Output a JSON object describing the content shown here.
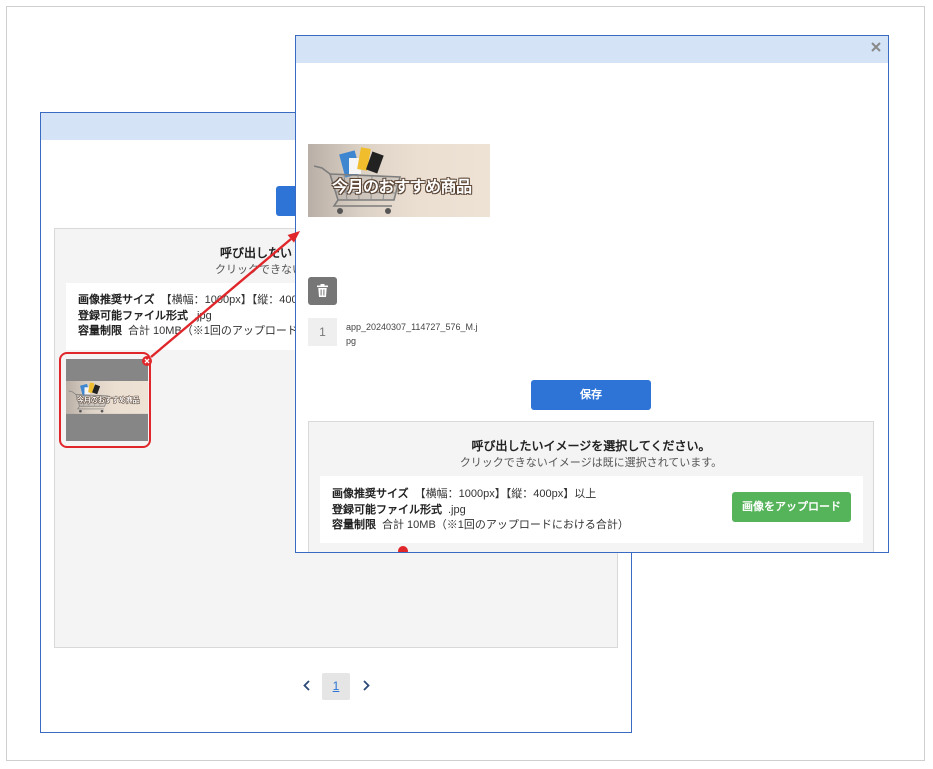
{
  "back_dialog": {
    "panel": {
      "heading": "呼び出したい",
      "subheading": "クリックできない"
    },
    "info": {
      "size_label": "画像推奨サイズ",
      "size_value": "【横幅：1000px】【縦：400p",
      "format_label": "登録可能ファイル形式",
      "format_value": ".jpg",
      "limit_label": "容量制限",
      "limit_value": "合計 10MB（※1回のアップロードに"
    },
    "thumbnail_remove_icon": "close-circle-icon",
    "pagination": {
      "current_page": "1",
      "prev_icon": "chevron-left-icon",
      "next_icon": "chevron-right-icon"
    }
  },
  "front_dialog": {
    "close_icon": "close-icon",
    "banner_text": "今月のおすすめ商品",
    "image_item": {
      "index": "1",
      "filename": "app_20240307_114727_576_M.jpg",
      "delete_icon": "trash-icon"
    },
    "save_label": "保存",
    "panel": {
      "heading": "呼び出したいイメージを選択してください。",
      "subheading": "クリックできないイメージは既に選択されています。"
    },
    "info": {
      "size_label": "画像推奨サイズ",
      "size_value": "【横幅：1000px】【縦：400px】以上",
      "format_label": "登録可能ファイル形式",
      "format_value": ".jpg",
      "limit_label": "容量制限",
      "limit_value": "合計 10MB（※1回のアップロードにおける合計）"
    },
    "upload_label": "画像をアップロード"
  },
  "colors": {
    "accent_blue": "#2d74d6",
    "dialog_border": "#3a6bc2",
    "dialog_header": "#d5e3f6",
    "upload_green": "#55b35a",
    "highlight_red": "#e0262a"
  }
}
